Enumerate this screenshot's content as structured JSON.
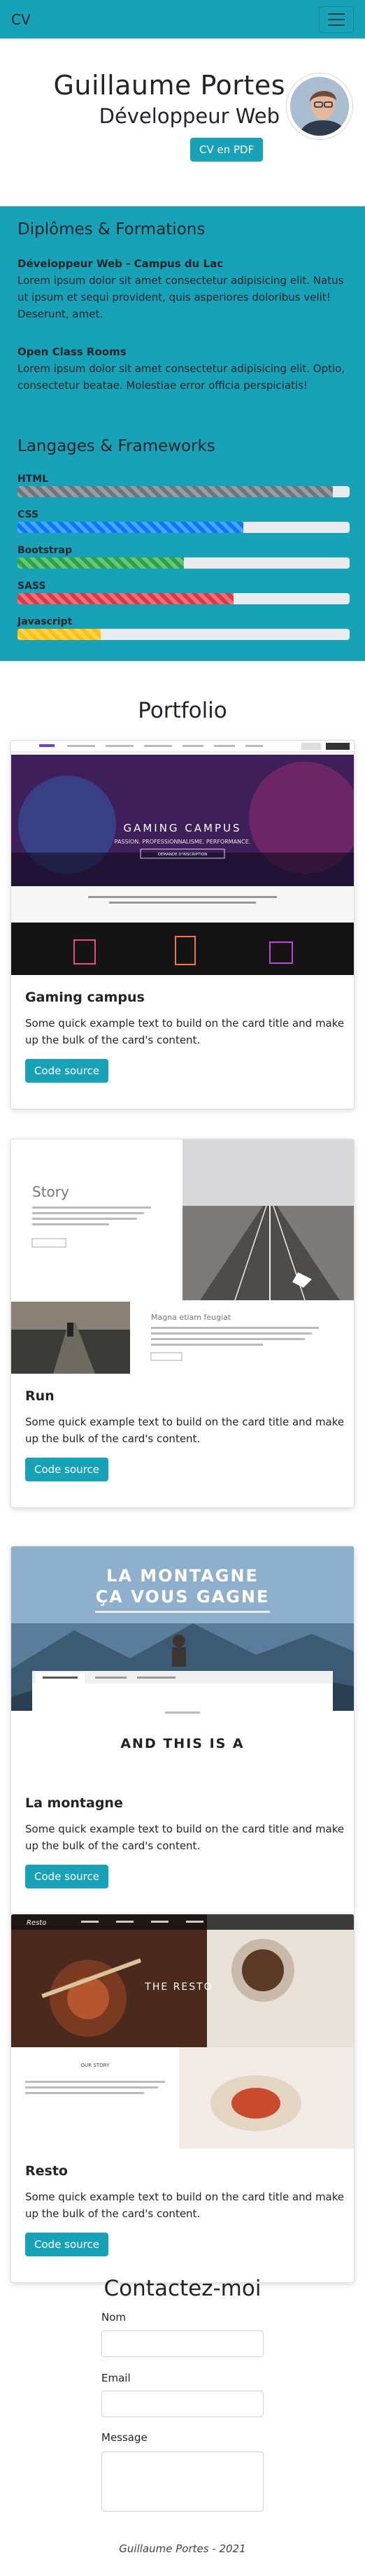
{
  "navbar": {
    "brand": "CV",
    "menu_icon": "hamburger-icon"
  },
  "hero": {
    "name": "Guillaume Portes",
    "role": "Développeur Web",
    "cv_button": "CV en PDF"
  },
  "education": {
    "title": "Diplômes & Formations",
    "items": [
      {
        "heading": "Développeur Web - Campus du Lac",
        "text": "Lorem ipsum dolor sit amet consectetur adipisicing elit. Natus ut ipsum et sequi provident, quis asperiores doloribus velit! Deserunt, amet."
      },
      {
        "heading": "Open Class Rooms",
        "text": "Lorem ipsum dolor sit amet consectetur adipisicing elit. Optio, consectetur beatae. Molestiae error officia perspiciatis!"
      }
    ]
  },
  "languages": {
    "title": "Langages & Frameworks",
    "skills": [
      {
        "name": "HTML",
        "level": 0.95,
        "color": "#6c757d"
      },
      {
        "name": "CSS",
        "level": 0.68,
        "color": "#007bff"
      },
      {
        "name": "Bootstrap",
        "level": 0.5,
        "color": "#28a745"
      },
      {
        "name": "SASS",
        "level": 0.65,
        "color": "#dc3545"
      },
      {
        "name": "Javascript",
        "level": 0.25,
        "color": "#ffc107"
      }
    ]
  },
  "portfolio": {
    "title": "Portfolio",
    "cards": [
      {
        "title": "Gaming campus",
        "text": "Some quick example text to build on the card title and make up the bulk of the card's content.",
        "button": "Code source"
      },
      {
        "title": "Run",
        "text": "Some quick example text to build on the card title and make up the bulk of the card's content.",
        "button": "Code source"
      },
      {
        "title": "La montagne",
        "text": "Some quick example text to build on the card title and make up the bulk of the card's content.",
        "button": "Code source"
      },
      {
        "title": "Resto",
        "text": "Some quick example text to build on the card title and make up the bulk of the card's content.",
        "button": "Code source"
      }
    ],
    "previews": {
      "gaming": {
        "headline": "GAMING CAMPUS",
        "tagline": "PASSION. PROFESSIONNALISME. PERFORMANCE.",
        "cta": "DEMANDE D'INSCRIPTION"
      },
      "run": {
        "story": "Story",
        "subhead": "Magna etiam feugiat"
      },
      "mountain": {
        "headline_1": "LA MONTAGNE",
        "headline_2": "ÇA VOUS GAGNE",
        "strap": "AND THIS IS A"
      },
      "resto": {
        "brand": "Resto",
        "headline": "THE RESTO",
        "story": "OUR STORY"
      }
    }
  },
  "contact": {
    "title": "Contactez-moi",
    "name_label": "Nom",
    "email_label": "Email",
    "message_label": "Message"
  },
  "footer": {
    "text": "Guillaume Portes - 2021"
  }
}
